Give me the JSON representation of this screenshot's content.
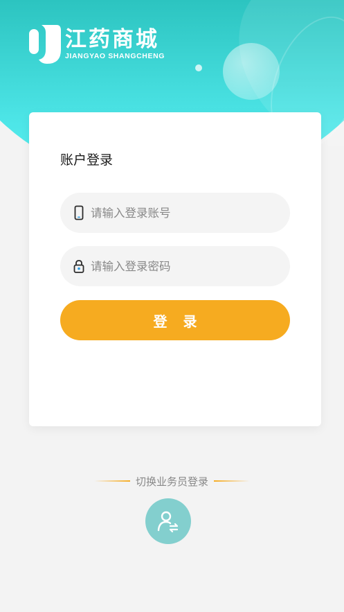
{
  "brand": {
    "name_cn": "江药商城",
    "name_en": "JIANGYAO SHANGCHENG"
  },
  "login_card": {
    "title": "账户登录",
    "account_placeholder": "请输入登录账号",
    "password_placeholder": "请输入登录密码",
    "login_label": "登 录"
  },
  "switch_login": {
    "label": "切换业务员登录"
  },
  "colors": {
    "primary": "#1aa9a3",
    "accent": "#f6ab20",
    "switch_button": "#83cfce"
  },
  "icons": {
    "account": "phone-icon",
    "password": "lock-icon",
    "switch": "user-switch-icon"
  }
}
